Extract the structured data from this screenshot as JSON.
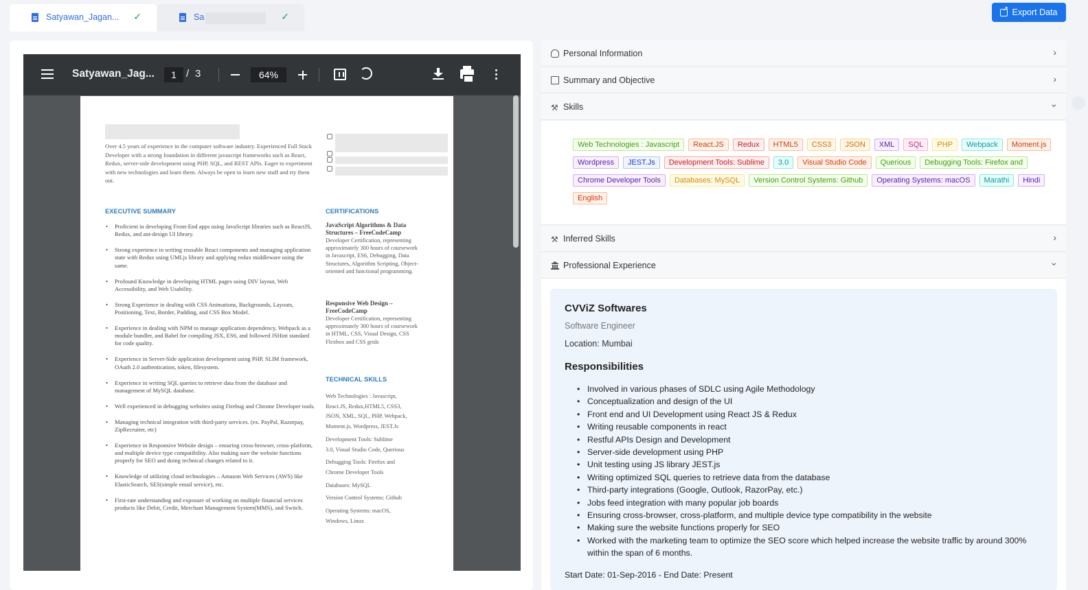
{
  "tabs": [
    {
      "label": "Satyawan_Jagan...",
      "status": "✓"
    },
    {
      "label": "Sa",
      "status": "✓"
    }
  ],
  "export_label": "Export Data",
  "viewer": {
    "title": "Satyawan_Jag...",
    "page_current": "1",
    "page_sep": "/",
    "page_total": "3",
    "zoom": "64%"
  },
  "resume": {
    "intro": "Over 4.5 years of experience in the computer software industry. Experienced Full Stack Developer with a strong foundation in different javascript frameworks such as React, Redux, server-side development using PHP, SQL, and REST APIs. Eager to experiment with new technologies and learn them. Always be open to learn new stuff and try them out.",
    "exec_heading": "EXECUTIVE SUMMARY",
    "exec_items": [
      "Proficient in developing Front-End apps using JavaScript libraries such as ReactJS, Redux, and ant-design UI library.",
      "Strong experience in writing reusable React components and managing application state with Redux using UMI.js library and applying redux middleware using the same.",
      "Profound Knowledge in developing HTML pages using DIV layout, Web Accessibility, and Web Usability.",
      "Strong Experience in dealing with CSS Animations, Backgrounds, Layouts, Positioning, Text, Border, Padding, and CSS Box Model.",
      "Experience in dealing with NPM to manage application dependency, Webpack as a module bundler, and Babel for compiling JSX, ES6, and followed JSHint standard for code quality.",
      "Experience in Server-Side application development using PHP, SLIM framework, OAuth 2.0 authentication, token, filesystem.",
      "Experience in writing SQL queries to retrieve data from the database and management of MySQL database.",
      "Well experienced in debugging websites using Firebug and Chrome Developer tools.",
      "Managing technical integration with third-party services. (ex. PayPal, Razorpay, ZipRecruiter, etc)",
      "Experience in Responsive Website design – ensuring cross-browser, cross-platform, and multiple device type compatibility. Also making sure the website functions properly for SEO and doing technical changes related to it.",
      "Knowledge of utilizing cloud technologies – Amazon Web Services (AWS) like ElasticSearch, SES(simple email service), etc.",
      "First-rate understanding and exposure of working on multiple financial services products like Debit, Credit, Merchant Management System(MMS), and Switch."
    ],
    "cert_heading": "CERTIFICATIONS",
    "cert1_title": "JavaScript Algorithms & Data Structures – FreeCodeCamp",
    "cert1_body": "Developer Certification, representing approximately 300 hours of coursework in Javascript, ES6, Debugging, Data Structures, Algorithm Scripting, Object-oriented and functional programming.",
    "cert2_title": "Responsive Web Design – FreeCodeCamp",
    "cert2_body": "Developer Certification, representing approximately 300 hours of coursework in HTML, CSS, Visual Design, CSS Flexbox and CSS grids",
    "tech_heading": "TECHNICAL SKILLS",
    "tech_lines": [
      "Web Technologies : Javascript,",
      "React.JS, Redux,HTML5, CSS3,",
      "JSON, XML, SQL, PHP, Webpack,",
      "Moment.js, Wordpress, JEST.Js",
      "Development Tools: Sublime",
      "3.0, Visual Studio Code, Querious",
      "Debugging Tools: Firefox and",
      "Chrome Developer Tools",
      "Databases: MySQL",
      "Version Control Systems: Github",
      "Operating Systems: macOS,",
      "Windows, Linux"
    ]
  },
  "sections": {
    "personal": "Personal Information",
    "summary": "Summary and Objective",
    "skills": "Skills",
    "inferred": "Inferred Skills",
    "experience": "Professional Experience"
  },
  "skills": [
    {
      "label": "Web Technologies : Javascript",
      "color": "green"
    },
    {
      "label": "React.JS",
      "color": "volcano"
    },
    {
      "label": "Redux",
      "color": "red"
    },
    {
      "label": "HTML5",
      "color": "volcano"
    },
    {
      "label": "CSS3",
      "color": "orange"
    },
    {
      "label": "JSON",
      "color": "orange"
    },
    {
      "label": "XML",
      "color": "purple"
    },
    {
      "label": "SQL",
      "color": "magenta"
    },
    {
      "label": "PHP",
      "color": "gold"
    },
    {
      "label": "Webpack",
      "color": "cyan"
    },
    {
      "label": "Moment.js",
      "color": "volcano"
    },
    {
      "label": "Wordpress",
      "color": "purple"
    },
    {
      "label": "JEST.Js",
      "color": "geek"
    },
    {
      "label": "Development Tools: Sublime",
      "color": "red"
    },
    {
      "label": "3.0",
      "color": "cyan"
    },
    {
      "label": "Visual Studio Code",
      "color": "volcano"
    },
    {
      "label": "Querious",
      "color": "green"
    },
    {
      "label": "Debugging Tools: Firefox and",
      "color": "green"
    },
    {
      "label": "Chrome Developer Tools",
      "color": "purple"
    },
    {
      "label": "Databases: MySQL",
      "color": "gold"
    },
    {
      "label": "Version Control Systems: Github",
      "color": "green"
    },
    {
      "label": "Operating Systems: macOS",
      "color": "purple"
    },
    {
      "label": "Marathi",
      "color": "cyan"
    },
    {
      "label": "Hindi",
      "color": "purple"
    },
    {
      "label": "English",
      "color": "volcano"
    }
  ],
  "experience": {
    "company": "CVViZ Softwares",
    "role": "Software Engineer",
    "location": "Location: Mumbai",
    "resp_heading": "Responsibilities",
    "responsibilities": [
      "Involved in various phases of SDLC using Agile Methodology",
      "Conceptualization and design of the UI",
      "Front end and UI Development using React JS & Redux",
      "Writing reusable components in react",
      "Restful APIs Design and Development",
      "Server-side development using PHP",
      "Unit testing using JS library JEST.js",
      "Writing optimized SQL queries to retrieve data from the database",
      "Third-party integrations (Google, Outlook, RazorPay, etc.)",
      "Jobs feed integration with many popular job boards",
      "Ensuring cross-browser, cross-platform, and multiple device type compatibility in the website",
      "Making sure the website functions properly for SEO",
      "Worked with the marketing team to optimize the SEO score which helped increase the website traffic by around 300% within the span of 6 months."
    ],
    "dates": "Start Date: 01-Sep-2016 - End Date: Present"
  }
}
